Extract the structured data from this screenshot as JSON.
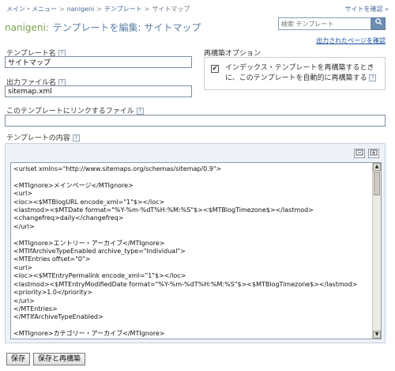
{
  "breadcrumb": {
    "items": [
      "メイン・メニュー",
      "nanigeni",
      "テンプレート",
      "サイトマップ"
    ],
    "separator": ">"
  },
  "header": {
    "site_link": "サイトを確認 »",
    "blog_name": "nanigeni:",
    "page_title": "テンプレートを編集: サイトマップ"
  },
  "search": {
    "placeholder": "検索 テンプレート"
  },
  "published_link": "出力されたページを確認",
  "form": {
    "template_name_label": "テンプレート名",
    "template_name_value": "サイトマップ",
    "output_file_label": "出力ファイル名",
    "output_file_value": "sitemap.xml",
    "rebuild_options_label": "再構築オプション",
    "rebuild_checkbox_checked": true,
    "rebuild_checkbox_label": "インデックス・テンプレートを再構築するときに、このテンプレートを自動的に再構築する",
    "link_file_label": "このテンプレートにリンクするファイル",
    "link_file_value": "",
    "content_label": "テンプレートの内容"
  },
  "editor": {
    "content": "<urlset xmlns=\"http://www.sitemaps.org/schemas/sitemap/0.9\">\n\n<MTIgnore>メインページ</MTIgnore>\n<url>\n<loc><$MTBlogURL encode_xml=\"1\"$></loc>\n<lastmod><$MTDate format=\"%Y-%m-%dT%H:%M:%S\"$><$MTBlogTimezone$></lastmod>\n<changefreq>daily</changefreq>\n</url>\n\n<MTIgnore>エントリー・アーカイブ</MTIgnore>\n<MTIfArchiveTypeEnabled archive_type=\"Individual\">\n<MTEntries offset=\"0\">\n<url>\n<loc><$MTEntryPermalink encode_xml=\"1\"$></loc>\n<lastmod><$MTEntryModifiedDate format=\"%Y-%m-%dT%H:%M:%S\"$><$MTBlogTimezone$></lastmod>\n<priority>1.0</priority>\n</url>\n</MTEntries>\n</MTIfArchiveTypeEnabled>\n\n<MTIgnore>カテゴリー・アーカイブ</MTIgnore>\n<MTIfArchiveTypeEnabled archive_type=\"Category\">"
  },
  "buttons": {
    "save": "保存",
    "save_rebuild": "保存と再構築"
  },
  "colors": {
    "blog_name": "#79a44a",
    "title": "#5c7fa6",
    "panel_bg": "#eef2f7",
    "search_button": "#6e8db4"
  }
}
